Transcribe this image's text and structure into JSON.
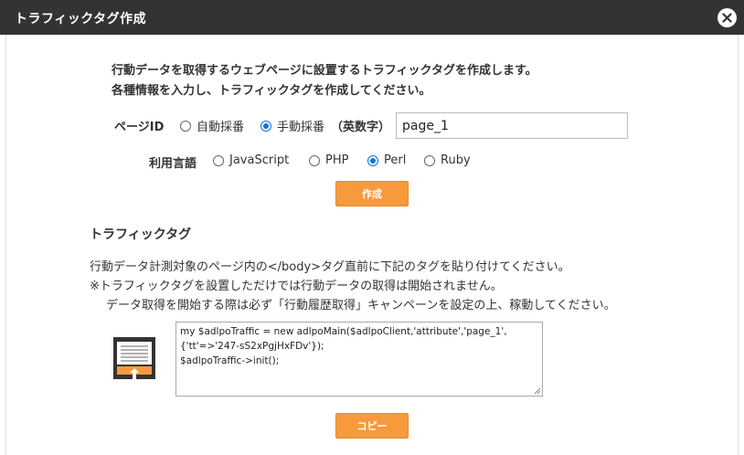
{
  "dialog": {
    "title": "トラフィックタグ作成",
    "close_icon": "close-icon"
  },
  "intro": {
    "line1": "行動データを取得するウェブページに設置するトラフィックタグを作成します。",
    "line2": "各種情報を入力し、トラフィックタグを作成してください。"
  },
  "page_id": {
    "label": "ページID",
    "options": [
      {
        "label": "自動採番",
        "selected": false
      },
      {
        "label": "手動採番",
        "selected": true
      }
    ],
    "suffix": "（英数字）",
    "value": "page_1"
  },
  "language": {
    "label": "利用言語",
    "options": [
      {
        "label": "JavaScript",
        "selected": false
      },
      {
        "label": "PHP",
        "selected": false
      },
      {
        "label": "Perl",
        "selected": true
      },
      {
        "label": "Ruby",
        "selected": false
      }
    ]
  },
  "create_button": "作成",
  "traffic_tag": {
    "title": "トラフィックタグ",
    "desc1": "行動データ計測対象のページ内の</body>タグ直前に下記のタグを貼り付けてください。",
    "desc2": "※トラフィックタグを設置しただけでは行動データの取得は開始されません。",
    "desc3": "データ取得を開始する際は必ず「行動履歴取得」キャンペーンを設定の上、稼動してください。",
    "code_lines": [
      "my $adlpoTraffic = new adlpoMain($adlpoClient,'attribute','page_1',",
      "{'tt'=>'247-sS2xPgjHxFDv'});",
      "$adlpoTraffic->init();"
    ],
    "icon": "upload-document-icon"
  },
  "copy_button": "コピー",
  "colors": {
    "titlebar": "#333333",
    "accent_button": "#f79a3d",
    "radio_selected": "#0a74d9"
  }
}
